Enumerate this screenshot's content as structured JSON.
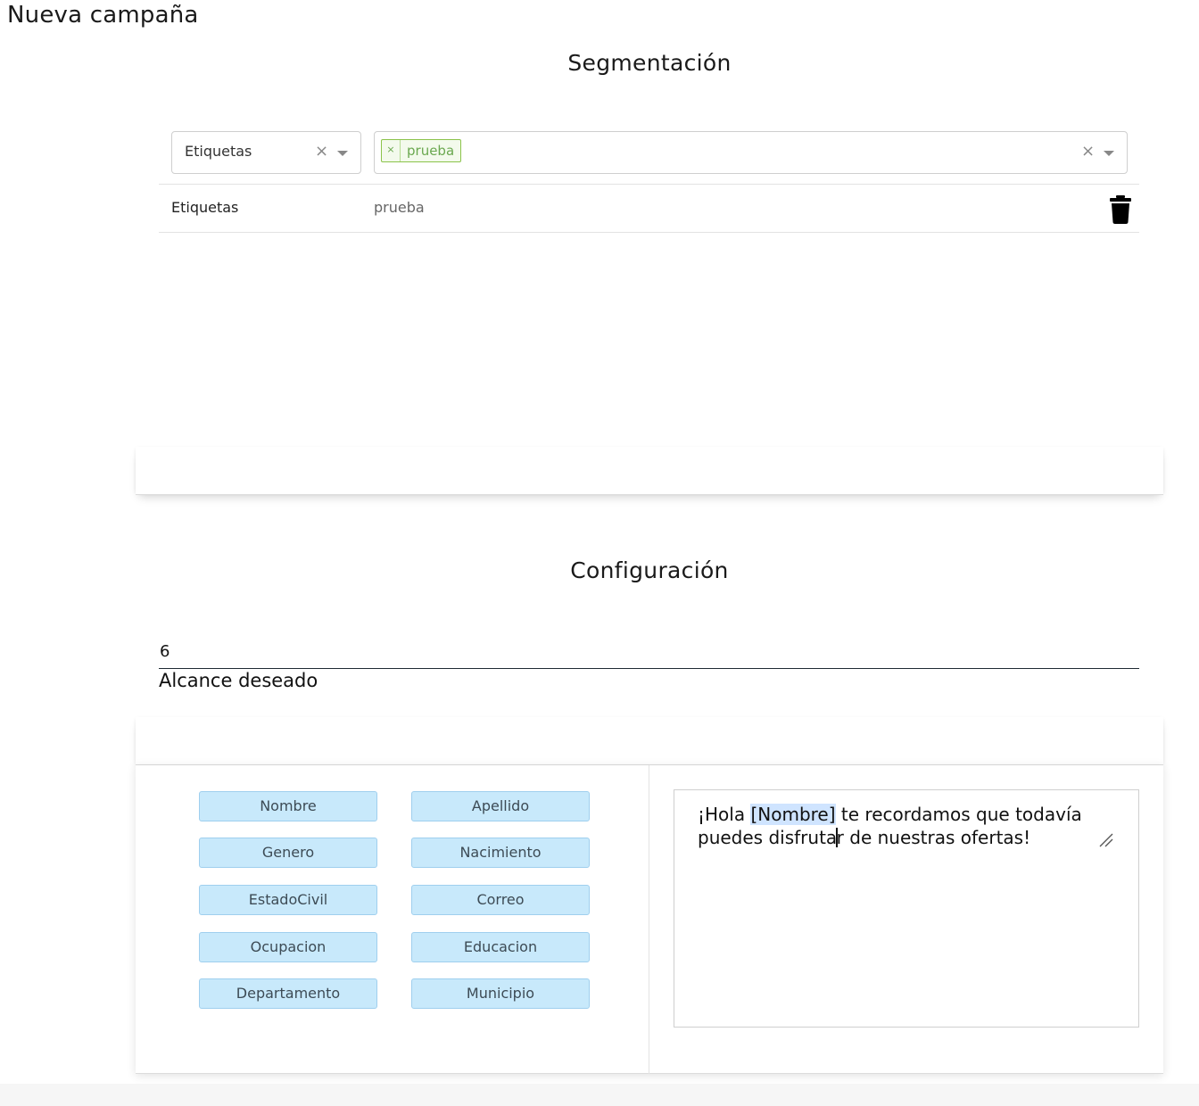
{
  "page": {
    "title": "Nueva campaña"
  },
  "segmentation": {
    "title": "Segmentación",
    "type_select": {
      "value": "Etiquetas"
    },
    "values_select": {
      "tags": [
        "prueba"
      ]
    },
    "table": {
      "rows": [
        {
          "field": "Etiquetas",
          "value": "prueba"
        }
      ]
    },
    "icons": {
      "clear": "close-icon",
      "dropdown": "chevron-down-icon",
      "remove": "trash-icon"
    }
  },
  "configuration": {
    "title": "Configuración",
    "reach_value": "6",
    "reach_label": "Alcance deseado"
  },
  "editor": {
    "variables": [
      "Nombre",
      "Apellido",
      "Genero",
      "Nacimiento",
      "EstadoCivil",
      "Correo",
      "Ocupacion",
      "Educacion",
      "Departamento",
      "Municipio"
    ],
    "message": {
      "part_before": "¡Hola ",
      "highlighted": "[Nombre]",
      "part_middle": " te recordamos que todavía puedes disfruta",
      "part_after": "r de nuestras ofertas!"
    },
    "colors": {
      "variable_bg": "#c8e9fb",
      "highlight": "#cfe4ff",
      "tag_green": "#6aa84f"
    }
  }
}
